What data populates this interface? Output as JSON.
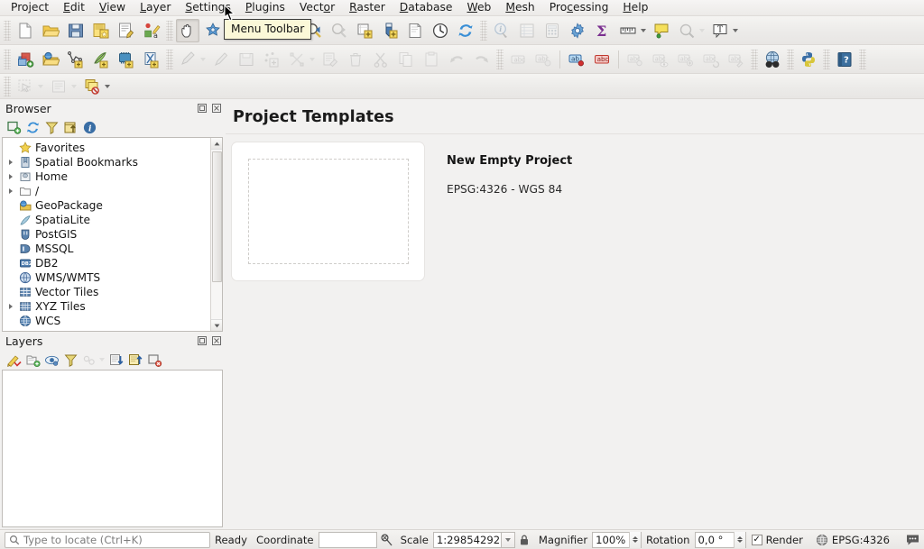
{
  "menu": {
    "items": [
      {
        "label": "Project",
        "mnemonic": ""
      },
      {
        "label": "Edit",
        "mnemonic": "E"
      },
      {
        "label": "View",
        "mnemonic": "V"
      },
      {
        "label": "Layer",
        "mnemonic": "L"
      },
      {
        "label": "Settings",
        "mnemonic": "S"
      },
      {
        "label": "Plugins",
        "mnemonic": "P"
      },
      {
        "label": "Vector",
        "mnemonic": "o"
      },
      {
        "label": "Raster",
        "mnemonic": "R"
      },
      {
        "label": "Database",
        "mnemonic": "D"
      },
      {
        "label": "Web",
        "mnemonic": "W"
      },
      {
        "label": "Mesh",
        "mnemonic": "M"
      },
      {
        "label": "Processing",
        "mnemonic": "c"
      },
      {
        "label": "Help",
        "mnemonic": "H"
      }
    ]
  },
  "tooltip": {
    "text": "Menu Toolbar"
  },
  "browser": {
    "title": "Browser",
    "toolbar": [
      "add-layer-icon",
      "refresh-icon",
      "filter-icon",
      "collapse-all-icon",
      "properties-icon"
    ],
    "items": [
      {
        "label": "Favorites",
        "icon": "star-icon",
        "expandable": false
      },
      {
        "label": "Spatial Bookmarks",
        "icon": "bookmark-icon",
        "expandable": true
      },
      {
        "label": "Home",
        "icon": "home-icon",
        "expandable": true
      },
      {
        "label": "/",
        "icon": "folder-icon",
        "expandable": true
      },
      {
        "label": "GeoPackage",
        "icon": "geopackage-icon",
        "expandable": false
      },
      {
        "label": "SpatiaLite",
        "icon": "spatialite-icon",
        "expandable": false
      },
      {
        "label": "PostGIS",
        "icon": "postgis-icon",
        "expandable": false
      },
      {
        "label": "MSSQL",
        "icon": "mssql-icon",
        "expandable": false
      },
      {
        "label": "DB2",
        "icon": "db2-icon",
        "expandable": false
      },
      {
        "label": "WMS/WMTS",
        "icon": "wms-icon",
        "expandable": false
      },
      {
        "label": "Vector Tiles",
        "icon": "vectortiles-icon",
        "expandable": false
      },
      {
        "label": "XYZ Tiles",
        "icon": "xyztiles-icon",
        "expandable": true
      },
      {
        "label": "WCS",
        "icon": "wcs-icon",
        "expandable": false
      }
    ]
  },
  "layers": {
    "title": "Layers",
    "toolbar": [
      "open-layer-styling-icon",
      "add-group-icon",
      "manage-visibility-icon",
      "filter-legend-icon",
      "expression-filter-icon",
      "expand-all-icon",
      "collapse-all-icon",
      "remove-layer-icon"
    ]
  },
  "main": {
    "heading": "Project Templates",
    "template": {
      "name": "New Empty Project",
      "crs": "EPSG:4326 - WGS 84"
    }
  },
  "statusbar": {
    "locator_placeholder": "Type to locate (Ctrl+K)",
    "ready": "Ready",
    "coordinate_label": "Coordinate",
    "coordinate_value": "",
    "scale_label": "Scale",
    "scale_value": "1:29854292",
    "magnifier_label": "Magnifier",
    "magnifier_value": "100%",
    "rotation_label": "Rotation",
    "rotation_value": "0,0 °",
    "render_label": "Render",
    "render_checked": "✓",
    "crs_value": "EPSG:4326"
  },
  "colors": {
    "accent_blue": "#3a6ea5",
    "tooltip_bg": "#fbf8d8",
    "panel_bg": "#f2f1f0",
    "folder_yellow": "#e8c85a",
    "sigma_purple": "#7a2f8f"
  }
}
